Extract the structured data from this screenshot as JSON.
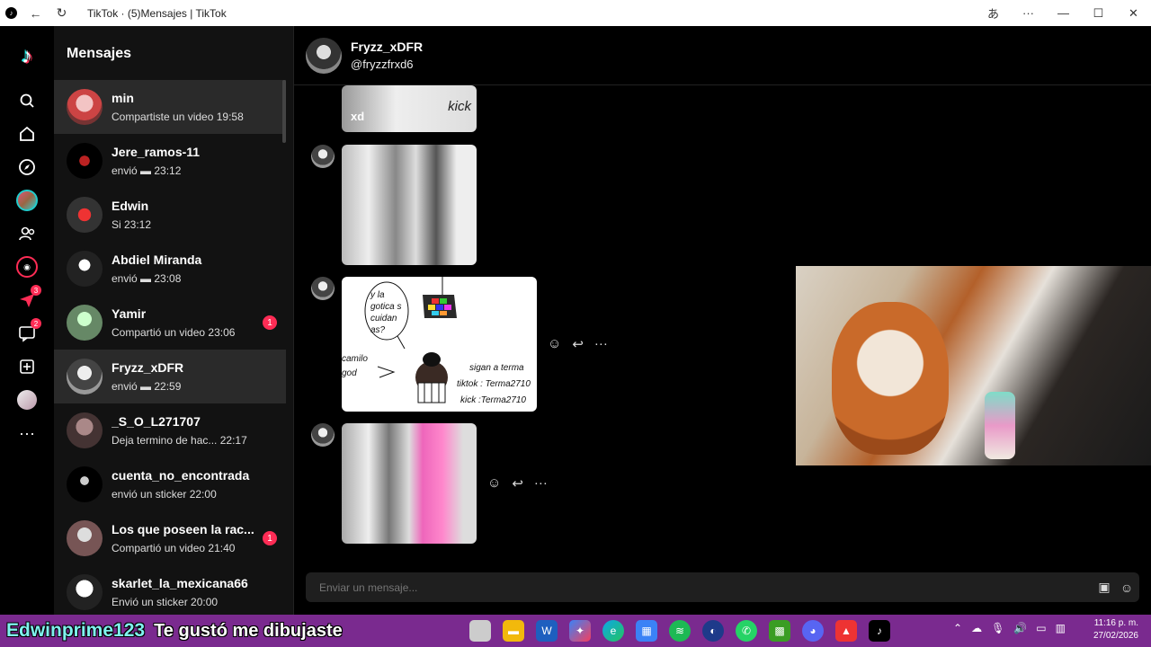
{
  "window": {
    "title": "TikTok · (5)Mensajes | TikTok"
  },
  "rail": {
    "badge_activity": "3",
    "badge_inbox": "2"
  },
  "conversations": {
    "heading": "Mensajes",
    "items": [
      {
        "name": "min",
        "sub": "Compartiste un video 19:58",
        "unread": "",
        "active": true
      },
      {
        "name": "Jere_ramos-11",
        "sub": "envió ▬ 23:12",
        "unread": "",
        "active": false
      },
      {
        "name": "Edwin",
        "sub": "Si 23:12",
        "unread": "",
        "active": false
      },
      {
        "name": "Abdiel Miranda",
        "sub": "envió ▬ 23:08",
        "unread": "",
        "active": false
      },
      {
        "name": "Yamir",
        "sub": "Compartió un video 23:06",
        "unread": "1",
        "active": false
      },
      {
        "name": "Fryzz_xDFR",
        "sub": "envió ▬ 22:59",
        "unread": "",
        "active": true
      },
      {
        "name": "_S_O_L271707",
        "sub": "Deja termino de hac... 22:17",
        "unread": "",
        "active": false
      },
      {
        "name": "cuenta_no_encontrada",
        "sub": "envió un sticker 22:00",
        "unread": "",
        "active": false
      },
      {
        "name": "Los que poseen la rac...",
        "sub": "Compartió un video 21:40",
        "unread": "1",
        "active": false
      },
      {
        "name": "skarlet_la_mexicana66",
        "sub": "Envió un sticker 20:00",
        "unread": "",
        "active": false
      }
    ]
  },
  "chat": {
    "display_name": "Fryzz_xDFR",
    "handle": "@fryzzfrxd6",
    "image1_caption_left": "xd",
    "image1_caption_right": "kick",
    "drawing": {
      "bubble": "y la gotica s cuidan as?",
      "left": "camilo god",
      "right1": "sigan a terma",
      "right2": "tiktok : Terma2710",
      "right3": "kick :Terma2710"
    },
    "composer_placeholder": "Enviar un mensaje..."
  },
  "taskbar": {
    "stream_user": "Edwinprime123",
    "stream_message": "Te gustó me dibujaste",
    "time": "11:16 p. m.",
    "date": "27/02/2026"
  }
}
